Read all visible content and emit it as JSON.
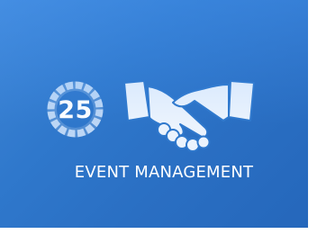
{
  "tile": {
    "title": "EVENT MANAGEMENT",
    "badge_count": "25",
    "icon": "handshake-icon",
    "colors": {
      "background": "#2f78cc",
      "text": "#ffffff",
      "icon_fill": "#ebf3fd",
      "badge_ring": "#9ec5f0"
    }
  }
}
